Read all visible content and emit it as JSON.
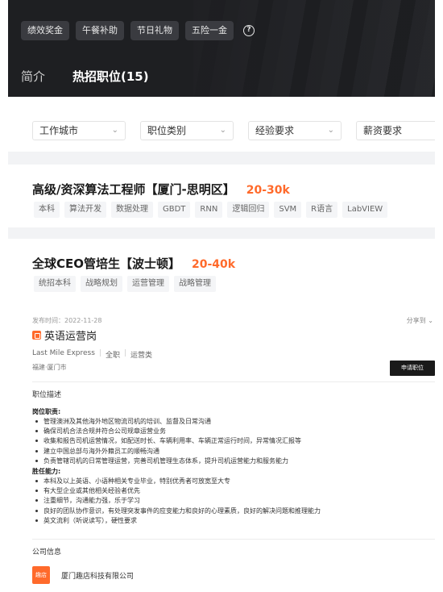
{
  "header": {
    "benefits": [
      "绩效奖金",
      "午餐补助",
      "节日礼物",
      "五险一金"
    ],
    "tabs": [
      {
        "label": "简介",
        "active": false
      },
      {
        "label": "热招职位(15)",
        "active": true
      }
    ]
  },
  "filters": [
    {
      "label": "工作城市"
    },
    {
      "label": "职位类别"
    },
    {
      "label": "经验要求"
    },
    {
      "label": "薪资要求"
    }
  ],
  "jobs": [
    {
      "title": "高级/资深算法工程师【厦门-思明区】",
      "salary": "20-30k",
      "tags": [
        "本科",
        "算法开发",
        "数据处理",
        "GBDT",
        "RNN",
        "逻辑回归",
        "SVM",
        "R语言",
        "LabVIEW"
      ]
    },
    {
      "title": "全球CEO管培生【波士顿】",
      "salary": "20-40k",
      "tags": [
        "统招本科",
        "战略规划",
        "运营管理",
        "战略管理"
      ]
    }
  ],
  "detail": {
    "posted": "发布时间：2022-11-28",
    "share": "分享到",
    "job_name": "英语运营岗",
    "company_short": "Last Mile Express",
    "type": "全职",
    "category": "运营类",
    "city": "福建·厦门市",
    "apply_label": "申请职位",
    "desc_title": "职位描述",
    "duties_title": "岗位职责:",
    "duties": [
      "管理澳洲及其他海外地区物流司机的培训、监督及日常沟通",
      "确保司机合法合规并符合公司规章运营业务",
      "收集和报告司机运营情况，如配送时长、车辆利用率、车辆正常运行时间，异常情况汇报等",
      "建立中国总部与海外外籍员工的顺畅沟通",
      "负责管辖司机的日常管理运营，完善司机管理生态体系，提升司机运营能力和服务能力"
    ],
    "req_title": "胜任能力:",
    "requirements": [
      "本科及以上英语、小语种相关专业毕业，特别优秀者可放宽至大专",
      "有大型企业或其他相关经验者优先",
      "注重细节，沟通能力强，乐于学习",
      "良好的团队协作意识，有处理突发事件的应变能力和良好的心理素质，良好的解决问题和推理能力",
      "英文流利（听说读写），硬性要求"
    ],
    "company_title": "公司信息",
    "company_logo_text": "趣店",
    "company_name": "厦门趣店科技有限公司"
  }
}
